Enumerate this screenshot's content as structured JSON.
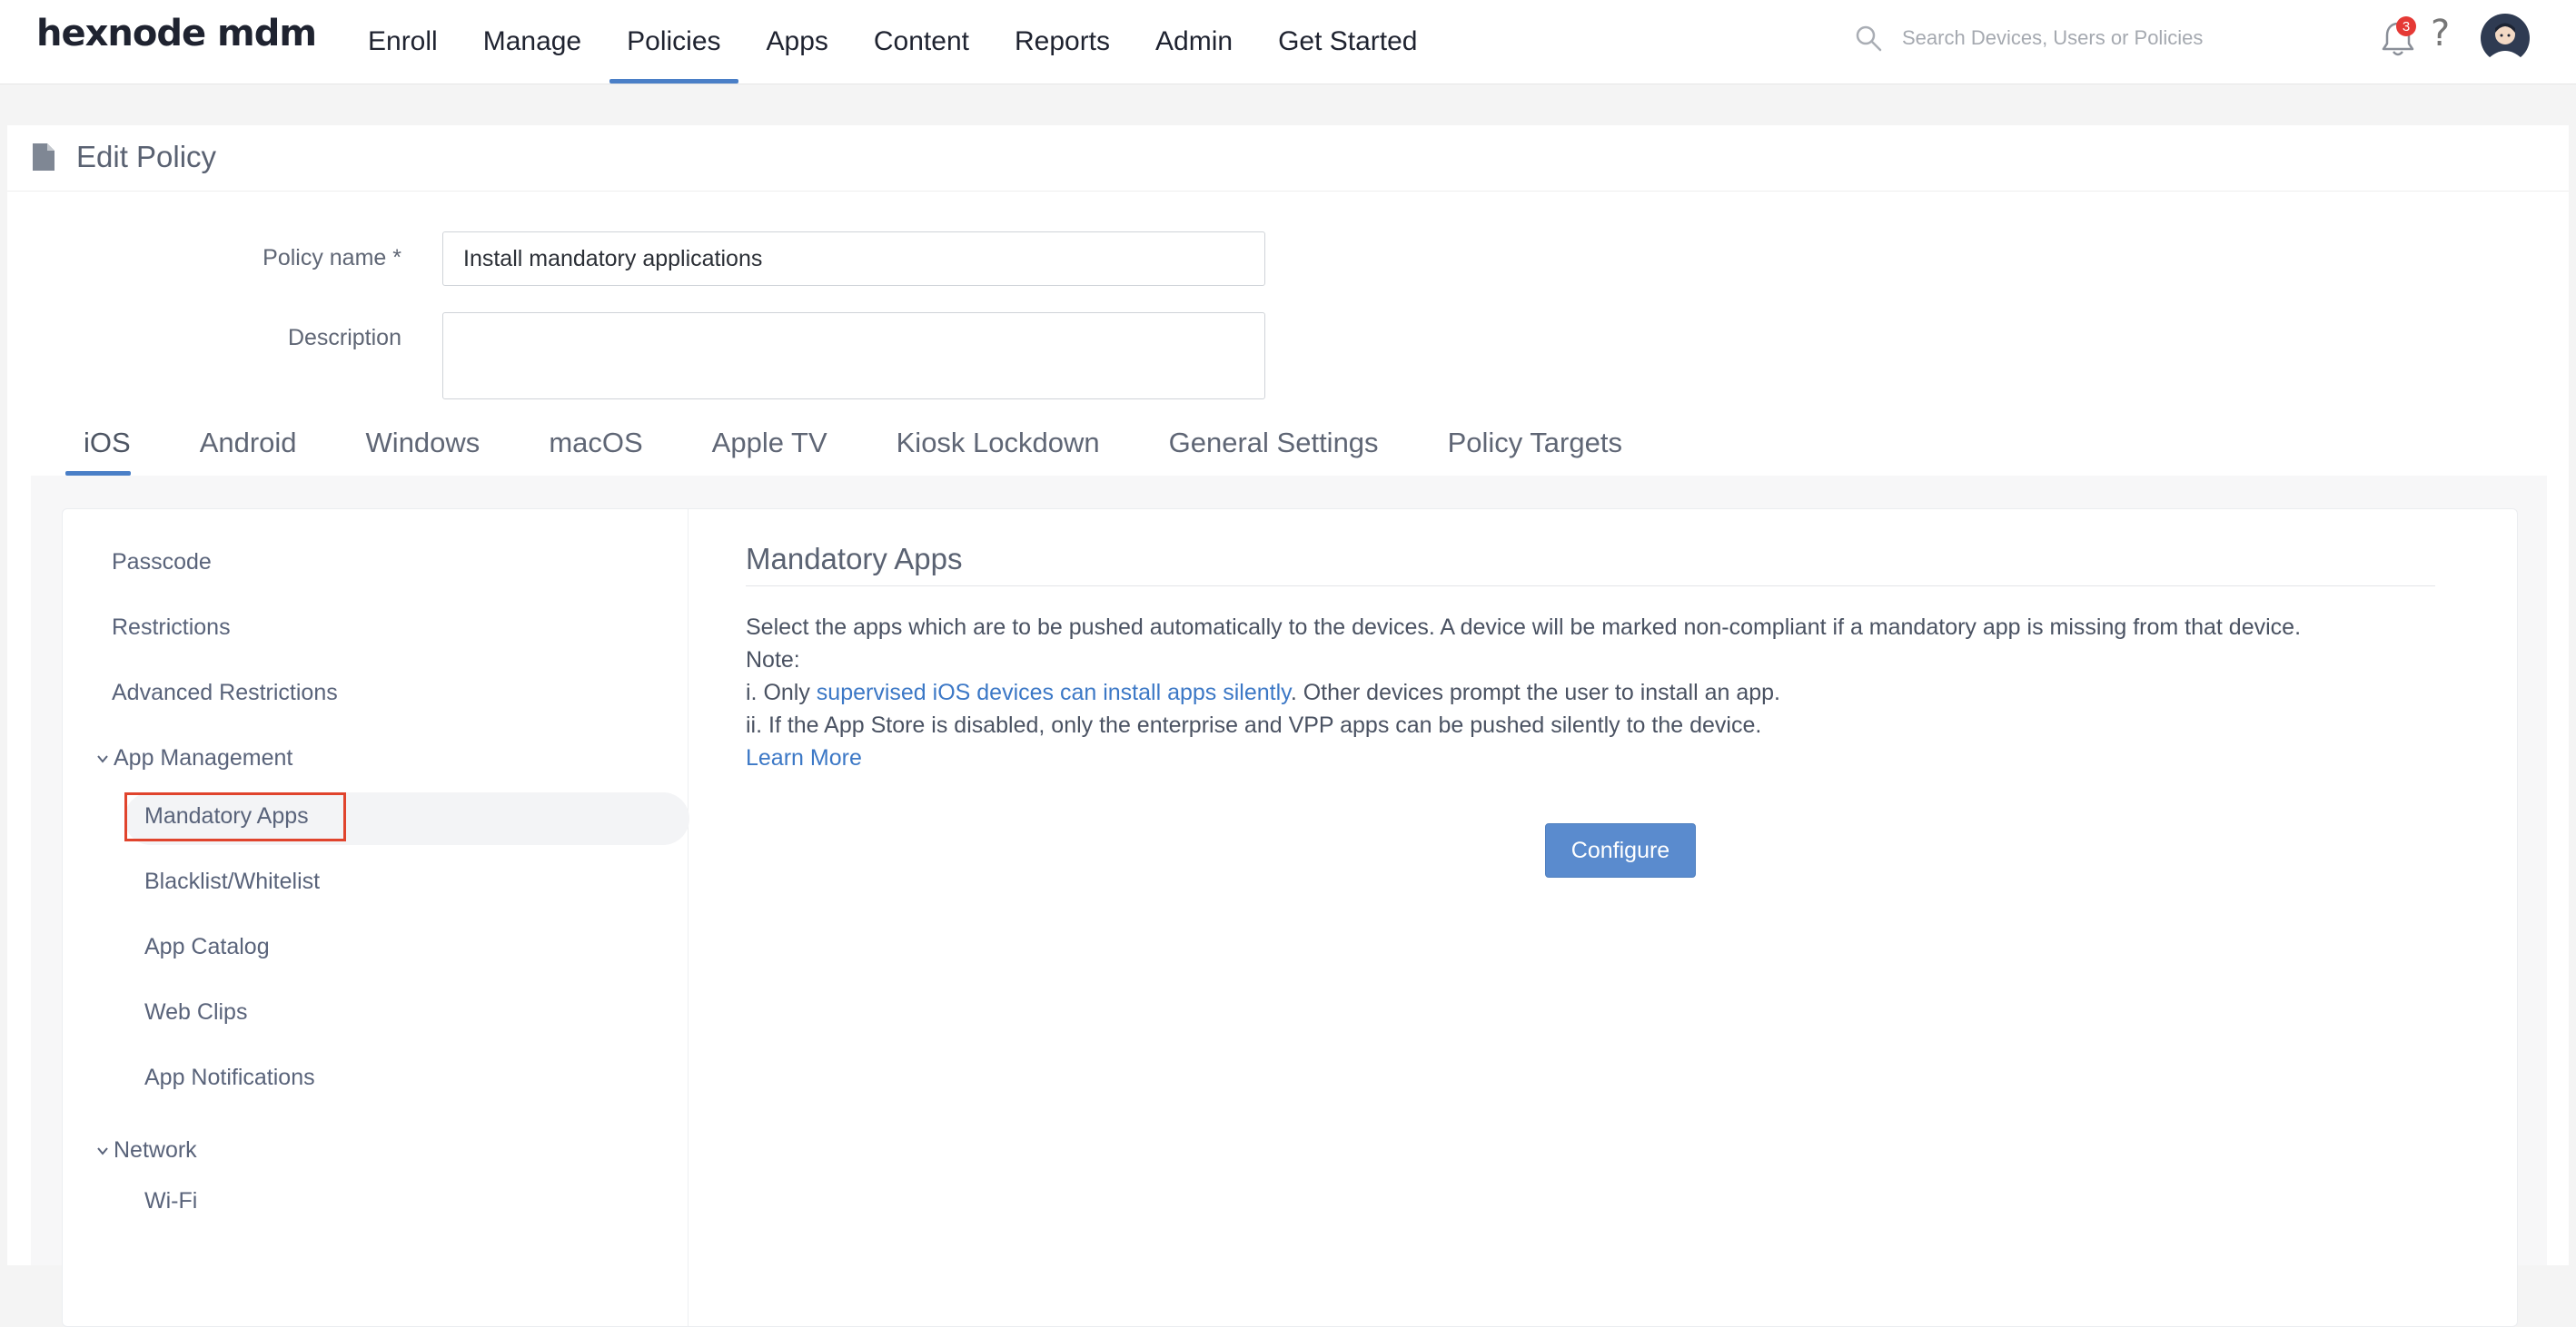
{
  "app": {
    "logo": "hexnode mdm"
  },
  "nav": {
    "items": [
      "Enroll",
      "Manage",
      "Policies",
      "Apps",
      "Content",
      "Reports",
      "Admin",
      "Get Started"
    ],
    "active": "Policies"
  },
  "search": {
    "placeholder": "Search Devices, Users or Policies"
  },
  "notifications": {
    "count": "3"
  },
  "help": {
    "glyph": "?"
  },
  "page": {
    "title": "Edit Policy"
  },
  "form": {
    "policy_name_label": "Policy name *",
    "policy_name_value": "Install mandatory applications",
    "description_label": "Description",
    "description_value": ""
  },
  "tabs": [
    "iOS",
    "Android",
    "Windows",
    "macOS",
    "Apple TV",
    "Kiosk Lockdown",
    "General Settings",
    "Policy Targets"
  ],
  "active_tab": "iOS",
  "sidebar": {
    "items": [
      "Passcode",
      "Restrictions",
      "Advanced Restrictions"
    ],
    "app_management": {
      "label": "App Management",
      "items": [
        "Mandatory Apps",
        "Blacklist/Whitelist",
        "App Catalog",
        "Web Clips",
        "App Notifications"
      ],
      "active": "Mandatory Apps"
    },
    "network": {
      "label": "Network",
      "items": [
        "Wi-Fi"
      ]
    }
  },
  "content": {
    "title": "Mandatory Apps",
    "intro": "Select the apps which are to be pushed automatically to the devices. A device will be marked non-compliant if a mandatory app is missing from that device.",
    "note": "Note:",
    "line1_prefix": "i. Only ",
    "line1_link": "supervised iOS devices can install apps silently",
    "line1_suffix": ". Other devices prompt the user to install an app.",
    "line2": "ii. If the App Store is disabled, only the enterprise and VPP apps can be pushed silently to the device.",
    "learn_more": "Learn More",
    "configure_button": "Configure"
  },
  "colors": {
    "accent": "#4a7fc7",
    "button": "#5a8bce",
    "link": "#3c78c6",
    "highlight": "#e0442d",
    "badge": "#e53935"
  }
}
